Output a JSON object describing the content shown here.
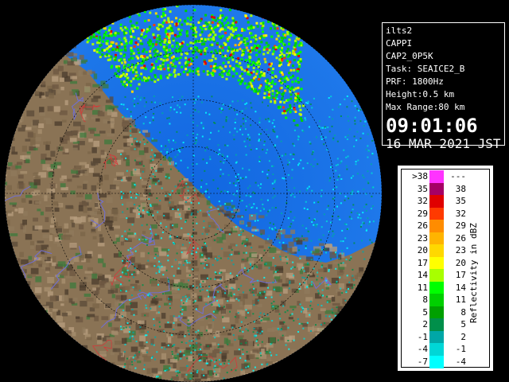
{
  "info": {
    "site": "ilts2",
    "product": "CAPPI",
    "product_id": "CAP2_0P5K",
    "task": "Task: SEAICE2_B",
    "prf": "PRF: 1800Hz",
    "height": "Height:0.5 km",
    "max_range": "Max Range:80 km",
    "time": "09:01:06",
    "date": "16 MAR 2021 JST"
  },
  "legend": {
    "title": "Reflectivity in dBZ",
    "rows": [
      {
        "lo": ">38",
        "hi": "---",
        "color": "#ff33ff"
      },
      {
        "lo": "35",
        "hi": "38",
        "color": "#a50066"
      },
      {
        "lo": "32",
        "hi": "35",
        "color": "#e00000"
      },
      {
        "lo": "29",
        "hi": "32",
        "color": "#ff3a00"
      },
      {
        "lo": "26",
        "hi": "29",
        "color": "#ff8c00"
      },
      {
        "lo": "23",
        "hi": "26",
        "color": "#ffb400"
      },
      {
        "lo": "20",
        "hi": "23",
        "color": "#ffd800"
      },
      {
        "lo": "17",
        "hi": "20",
        "color": "#ffff00"
      },
      {
        "lo": "14",
        "hi": "17",
        "color": "#a8ff00"
      },
      {
        "lo": "11",
        "hi": "14",
        "color": "#00ff00"
      },
      {
        "lo": "8",
        "hi": "11",
        "color": "#00d000"
      },
      {
        "lo": "5",
        "hi": "8",
        "color": "#00a000"
      },
      {
        "lo": "2",
        "hi": "5",
        "color": "#008f4a"
      },
      {
        "lo": "-1",
        "hi": "2",
        "color": "#00a7a7"
      },
      {
        "lo": "-4",
        "hi": "-1",
        "color": "#00d7d7"
      },
      {
        "lo": "-7",
        "hi": "-4",
        "color": "#00ffff"
      }
    ]
  },
  "colors": {
    "background": "#000000",
    "weak_echo": "#1e6ee6",
    "land_dark": "#5a4a38",
    "land_light": "#a89070",
    "rivers": "#6f6fd8",
    "boundaries": "#d23a3a",
    "range_rings": "#111111"
  }
}
